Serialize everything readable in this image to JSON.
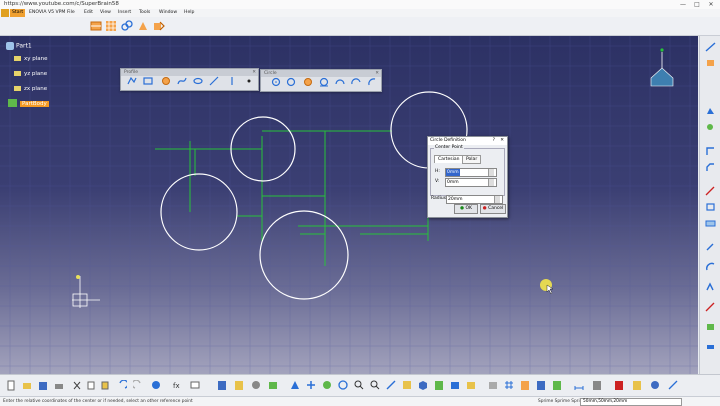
{
  "window": {
    "title": "https://www.youtube.com/c/SuperBrain58",
    "controls": [
      "—",
      "□",
      "✕"
    ]
  },
  "menu": {
    "items": [
      "Start",
      "ENOVIA V5 VPM",
      "File",
      "Edit",
      "View",
      "Insert",
      "Tools",
      "Window",
      "Help"
    ],
    "active": "Start"
  },
  "tree": {
    "root": "Part1",
    "nodes": [
      "xy plane",
      "yz plane",
      "zx plane",
      "PartBody"
    ],
    "highlighted": "PartBody"
  },
  "floating_toolbars": {
    "profile": {
      "title": "Profile",
      "close": "✕"
    },
    "circle": {
      "title": "Circle",
      "close": "✕"
    }
  },
  "dialog": {
    "title": "Circle Definition",
    "help": "?",
    "close": "✕",
    "frame_caption": "Center Point",
    "tabs": [
      "Cartesian",
      "Polar"
    ],
    "active_tab": "Cartesian",
    "fields": [
      {
        "label": "H:",
        "value": "0mm"
      },
      {
        "label": "V:",
        "value": "0mm"
      }
    ],
    "radius_label": "Radius:",
    "radius_value": "20mm",
    "ok": "OK",
    "cancel": "Cancel"
  },
  "status": {
    "message": "Enter the relative coordinates of the center or if needed, select an other reference point",
    "prompt_label": "Sprime Sprime Sprime",
    "prompt_value": "50mm,50mm,20mm"
  },
  "colors": {
    "canvas_top": "#2c3164",
    "canvas_bottom": "#a3a3bd",
    "geometry": "#ffffff",
    "dimension": "#27c23a",
    "highlight": "#f59a24"
  }
}
